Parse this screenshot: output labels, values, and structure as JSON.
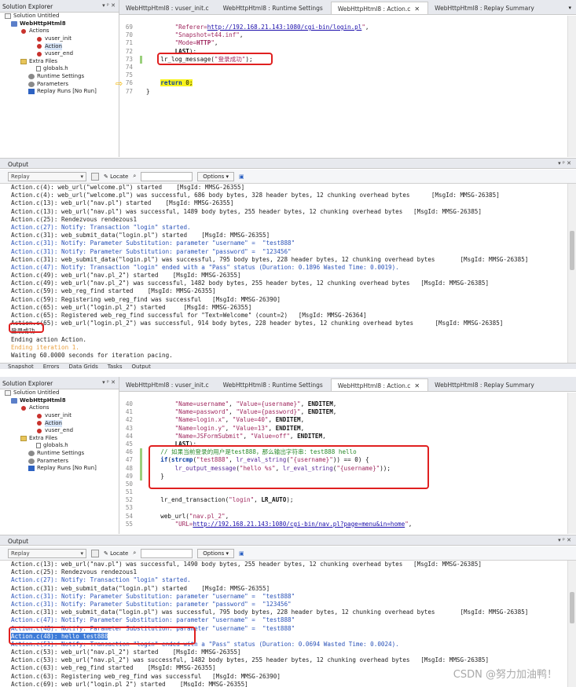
{
  "solution_explorer": {
    "title": "Solution Explorer",
    "controls": "▾ ᵖ ✕",
    "items": [
      {
        "label": "Solution Untitled",
        "icon": "solution-icon",
        "indent": 6
      },
      {
        "label": "WebHttpHtml8",
        "icon": "script-icon",
        "indent": 14,
        "bold": true
      },
      {
        "label": "Actions",
        "icon": "actions-icon",
        "indent": 26
      },
      {
        "label": "vuser_init",
        "icon": "action-icon",
        "indent": 46
      },
      {
        "label": "Action",
        "icon": "action-icon",
        "indent": 46,
        "selected": true
      },
      {
        "label": "vuser_end",
        "icon": "action-icon",
        "indent": 46
      },
      {
        "label": "Extra Files",
        "icon": "folder-icon",
        "indent": 26
      },
      {
        "label": "globals.h",
        "icon": "file-icon",
        "indent": 46
      },
      {
        "label": "Runtime Settings",
        "icon": "settings-icon",
        "indent": 36
      },
      {
        "label": "Parameters",
        "icon": "parameters-icon",
        "indent": 36
      },
      {
        "label": "Replay Runs [No Run]",
        "icon": "replay-icon",
        "indent": 36
      }
    ]
  },
  "tabs": [
    {
      "label": "WebHttpHtml8 : vuser_init.c"
    },
    {
      "label": "WebHttpHtml8 : Runtime Settings"
    },
    {
      "label": "WebHttpHtml8 : Action.c",
      "active": true
    },
    {
      "label": "WebHttpHtml8 : Replay Summary"
    }
  ],
  "editor1": {
    "lines": [
      {
        "n": "69",
        "html": "        <span class='str'>\"Referer=<span class='lnk'>http://192.168.21.143:1080/cgi-bin/login.pl</span>\"</span>,"
      },
      {
        "n": "70",
        "html": "        <span class='str'>\"Snapshot=t44.inf\"</span>,"
      },
      {
        "n": "71",
        "html": "        <span class='str'>\"Mode=<b>HTTP</b>\"</span>,"
      },
      {
        "n": "72",
        "html": "        <b>LAST</b>);"
      },
      {
        "n": "73",
        "html": "    lr_log_message(<span class='str'>\"登录成功\"</span>);"
      },
      {
        "n": "74",
        "html": ""
      },
      {
        "n": "75",
        "html": ""
      },
      {
        "n": "76",
        "html": "    <span class='hl'><span class='kw'>return</span> 0;</span>"
      },
      {
        "n": "77",
        "html": "}"
      }
    ]
  },
  "output1": {
    "title": "Output",
    "controls": "▾ ᵖ ✕",
    "replay": "Replay",
    "locate": "Locate",
    "options": "Options",
    "lines": [
      {
        "t": "Action.c(4): web_url(\"welcome.pl\") started    [MsgId: MMSG-26355]",
        "c": ""
      },
      {
        "t": "Action.c(4): web_url(\"welcome.pl\") was successful, 686 body bytes, 328 header bytes, 12 chunking overhead bytes      [MsgId: MMSG-26385]",
        "c": ""
      },
      {
        "t": "Action.c(13): web_url(\"nav.pl\") started    [MsgId: MMSG-26355]",
        "c": ""
      },
      {
        "t": "Action.c(13): web_url(\"nav.pl\") was successful, 1489 body bytes, 255 header bytes, 12 chunking overhead bytes   [MsgId: MMSG-26385]",
        "c": ""
      },
      {
        "t": "Action.c(25): Rendezvous rendezous1",
        "c": ""
      },
      {
        "t": "Action.c(27): Notify: Transaction \"login\" started.",
        "c": "blue"
      },
      {
        "t": "Action.c(31): web_submit_data(\"login.pl\") started    [MsgId: MMSG-26355]",
        "c": ""
      },
      {
        "t": "Action.c(31): Notify: Parameter Substitution: parameter \"username\" =  \"test888\"",
        "c": "blue"
      },
      {
        "t": "Action.c(31): Notify: Parameter Substitution: parameter \"password\" =  \"123456\"",
        "c": "blue"
      },
      {
        "t": "Action.c(31): web_submit_data(\"login.pl\") was successful, 795 body bytes, 228 header bytes, 12 chunking overhead bytes       [MsgId: MMSG-26385]",
        "c": ""
      },
      {
        "t": "Action.c(47): Notify: Transaction \"login\" ended with a \"Pass\" status (Duration: 0.1896 Wasted Time: 0.0019).",
        "c": "blue"
      },
      {
        "t": "Action.c(49): web_url(\"nav.pl_2\") started    [MsgId: MMSG-26355]",
        "c": ""
      },
      {
        "t": "Action.c(49): web_url(\"nav.pl_2\") was successful, 1482 body bytes, 255 header bytes, 12 chunking overhead bytes   [MsgId: MMSG-26385]",
        "c": ""
      },
      {
        "t": "Action.c(59): web_reg_find started    [MsgId: MMSG-26355]",
        "c": ""
      },
      {
        "t": "Action.c(59): Registering web_reg_find was successful   [MsgId: MMSG-26390]",
        "c": ""
      },
      {
        "t": "Action.c(65): web_url(\"login.pl_2\") started     [MsgId: MMSG-26355]",
        "c": ""
      },
      {
        "t": "Action.c(65): Registered web_reg_find successful for \"Text=Welcome\" (count=2)   [MsgId: MMSG-26364]",
        "c": ""
      },
      {
        "t": "Action.c(65): web_url(\"login.pl_2\") was successful, 914 body bytes, 228 header bytes, 12 chunking overhead bytes      [MsgId: MMSG-26385]",
        "c": ""
      },
      {
        "t": "登录成功",
        "c": ""
      },
      {
        "t": "Ending action Action.",
        "c": ""
      },
      {
        "t": "Ending iteration 1.",
        "c": "orange"
      },
      {
        "t": "Waiting 60.0000 seconds for iteration pacing.",
        "c": ""
      }
    ]
  },
  "bottom_tabs": [
    "Snapshot",
    "Errors",
    "Data Grids",
    "Tasks",
    "Output"
  ],
  "editor2": {
    "lines": [
      {
        "n": "40",
        "html": "        <span class='str'>\"Name=username\"</span>, <span class='str'>\"Value={username}\"</span>, <b>ENDITEM</b>,"
      },
      {
        "n": "41",
        "html": "        <span class='str'>\"Name=password\"</span>, <span class='str'>\"Value={password}\"</span>, <b>ENDITEM</b>,"
      },
      {
        "n": "42",
        "html": "        <span class='str'>\"Name=login.x\"</span>, <span class='str'>\"Value=40\"</span>, <b>ENDITEM</b>,"
      },
      {
        "n": "43",
        "html": "        <span class='str'>\"Name=login.y\"</span>, <span class='str'>\"Value=13\"</span>, <b>ENDITEM</b>,"
      },
      {
        "n": "44",
        "html": "        <span class='str'>\"Name=JSFormSubmit\"</span>, <span class='str'>\"Value=off\"</span>, <b>ENDITEM</b>,"
      },
      {
        "n": "45",
        "html": "        <b>LAST</b>);"
      },
      {
        "n": "46",
        "html": "    <span class='cm'>// 如果当前登录的用户是test888，那么输出字符串：test888 hello</span>"
      },
      {
        "n": "47",
        "html": "    <span class='kw'>if</span>(<span class='kw'>strcmp</span>(<span class='str'>\"test888\"</span>, <span class='fn'>lr_eval_string</span>(<span class='str'>\"{username}\"</span>)) == 0) {"
      },
      {
        "n": "48",
        "html": "        <span class='fn'>lr_output_message</span>(<span class='str'>\"hello %s\"</span>, <span class='fn'>lr_eval_string</span>(<span class='str'>\"{username}\"</span>));"
      },
      {
        "n": "49",
        "html": "    }"
      },
      {
        "n": "50",
        "html": ""
      },
      {
        "n": "51",
        "html": ""
      },
      {
        "n": "52",
        "html": "    lr_end_transaction(<span class='str'>\"login\"</span>, <b>LR_AUTO</b>);"
      },
      {
        "n": "53",
        "html": ""
      },
      {
        "n": "54",
        "html": "    web_url(<span class='str'>\"nav.pl_2\"</span>,"
      },
      {
        "n": "55",
        "html": "        <span class='str'>\"URL=<span class='lnk'>http://192.168.21.143:1080/cgi-bin/nav.pl?page=menu&amp;in=home</span>\"</span>,"
      }
    ]
  },
  "output2": {
    "title": "Output",
    "controls": "▾ ᵖ ✕",
    "replay": "Replay",
    "locate": "Locate",
    "options": "Options",
    "lines": [
      {
        "t": "Action.c(13): web_url(\"nav.pl\") was successful, 1490 body bytes, 255 header bytes, 12 chunking overhead bytes   [MsgId: MMSG-26385]",
        "c": ""
      },
      {
        "t": "Action.c(25): Rendezvous rendezous1",
        "c": ""
      },
      {
        "t": "Action.c(27): Notify: Transaction \"login\" started.",
        "c": "blue"
      },
      {
        "t": "Action.c(31): web_submit_data(\"login.pl\") started    [MsgId: MMSG-26355]",
        "c": ""
      },
      {
        "t": "Action.c(31): Notify: Parameter Substitution: parameter \"username\" =  \"test888\"",
        "c": "blue"
      },
      {
        "t": "Action.c(31): Notify: Parameter Substitution: parameter \"password\" =  \"123456\"",
        "c": "blue"
      },
      {
        "t": "Action.c(31): web_submit_data(\"login.pl\") was successful, 795 body bytes, 228 header bytes, 12 chunking overhead bytes       [MsgId: MMSG-26385]",
        "c": ""
      },
      {
        "t": "Action.c(47): Notify: Parameter Substitution: parameter \"username\" =  \"test888\"",
        "c": "blue"
      },
      {
        "t": "Action.c(48): Notify: Parameter Substitution: parameter \"username\" =  \"test888\"",
        "c": "blue"
      },
      {
        "t": "Action.c(48): hello test888",
        "c": "sel"
      },
      {
        "t": "Action.c(51): Notify: Transaction \"login\" ended with a \"Pass\" status (Duration: 0.0694 Wasted Time: 0.0024).",
        "c": "blue"
      },
      {
        "t": "Action.c(53): web_url(\"nav.pl_2\") started    [MsgId: MMSG-26355]",
        "c": ""
      },
      {
        "t": "Action.c(53): web_url(\"nav.pl_2\") was successful, 1482 body bytes, 255 header bytes, 12 chunking overhead bytes   [MsgId: MMSG-26385]",
        "c": ""
      },
      {
        "t": "Action.c(63): web_reg_find started    [MsgId: MMSG-26355]",
        "c": ""
      },
      {
        "t": "Action.c(63): Registering web_reg_find was successful   [MsgId: MMSG-26390]",
        "c": ""
      },
      {
        "t": "Action.c(69): web_url(\"login.pl_2\") started    [MsgId: MMSG-26355]",
        "c": ""
      }
    ]
  },
  "watermark": "CSDN @努力加油鸭！"
}
